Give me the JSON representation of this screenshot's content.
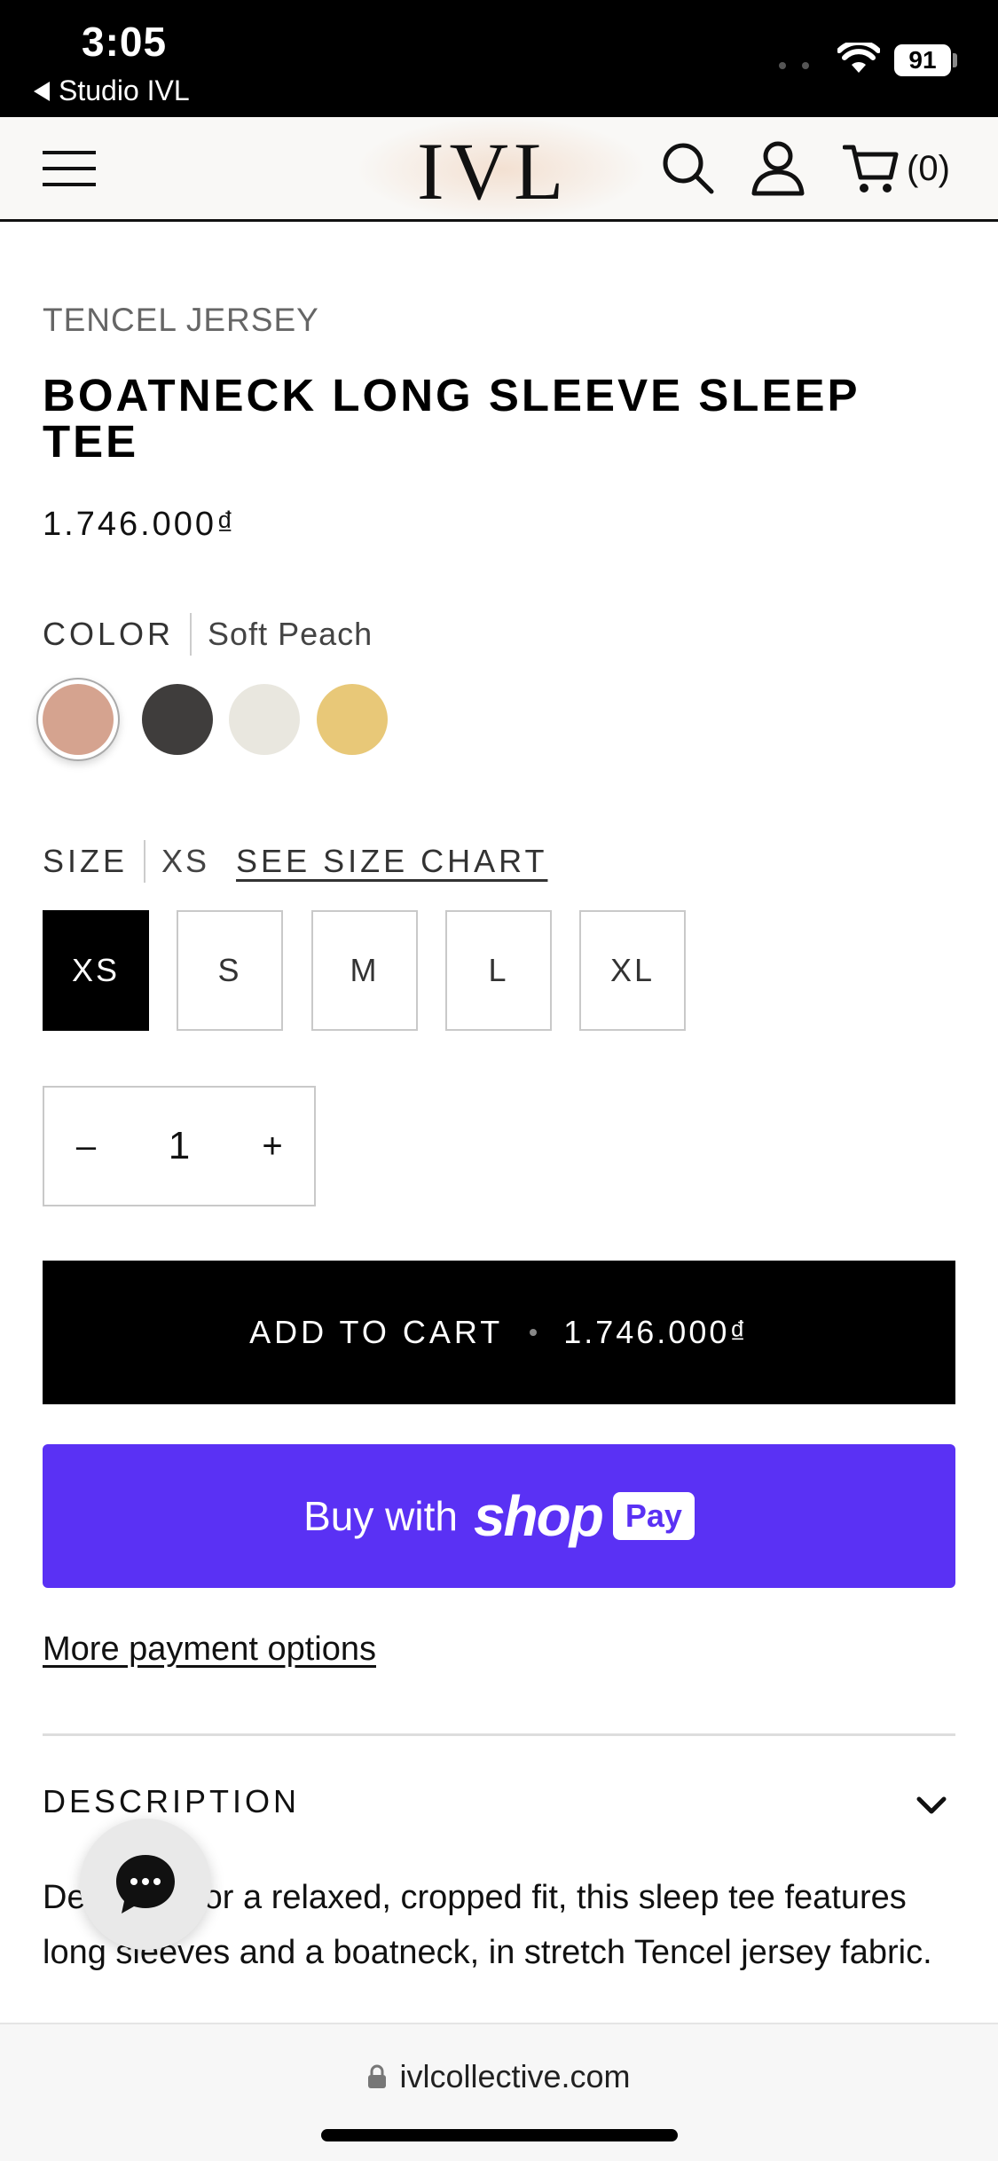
{
  "status_bar": {
    "time": "3:05",
    "back_app": "Studio IVL",
    "battery": "91"
  },
  "header": {
    "logo": "IVL",
    "cart_count": "(0)"
  },
  "product": {
    "category": "TENCEL JERSEY",
    "title": "BOATNECK LONG SLEEVE SLEEP TEE",
    "price": "1.746.000₫"
  },
  "color": {
    "label": "COLOR",
    "selected": "Soft Peach",
    "swatches": [
      {
        "name": "Soft Peach",
        "hex": "#d5a38f"
      },
      {
        "name": "Charcoal",
        "hex": "#3f3d3c"
      },
      {
        "name": "Ivory",
        "hex": "#e9e7df"
      },
      {
        "name": "Butter",
        "hex": "#e8c878"
      }
    ]
  },
  "size": {
    "label": "SIZE",
    "selected": "XS",
    "chart_link": "SEE SIZE CHART",
    "options": [
      "XS",
      "S",
      "M",
      "L",
      "XL"
    ]
  },
  "quantity": {
    "minus": "–",
    "value": "1",
    "plus": "+"
  },
  "add_to_cart": {
    "label": "ADD TO CART",
    "price": "1.746.000₫"
  },
  "shop_pay": {
    "prefix": "Buy with",
    "brand": "shop",
    "badge": "Pay",
    "color": "#5a31f4"
  },
  "more_payment": "More payment options",
  "description": {
    "heading": "DESCRIPTION",
    "text": "Designed for a relaxed, cropped fit, this sleep tee features long sleeves and a boatneck, in stretch Tencel jersey fabric."
  },
  "browser": {
    "url": "ivlcollective.com"
  }
}
